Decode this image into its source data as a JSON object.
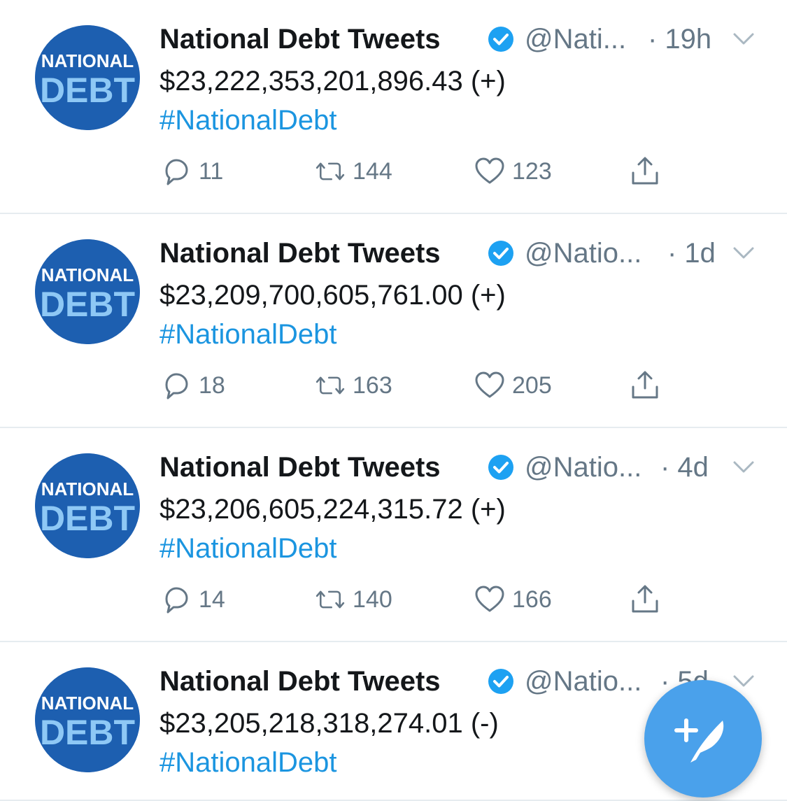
{
  "tweets": [
    {
      "name": "National Debt Tweets",
      "handle": "@Nati...",
      "time": "· 19h",
      "amount": "$23,222,353,201,896.43 (+)",
      "hashtag": "#NationalDebt",
      "replies": "11",
      "retweets": "144",
      "likes": "123"
    },
    {
      "name": "National Debt Tweets",
      "handle": "@Natio...",
      "time": "· 1d",
      "amount": "$23,209,700,605,761.00 (+)",
      "hashtag": "#NationalDebt",
      "replies": "18",
      "retweets": "163",
      "likes": "205"
    },
    {
      "name": "National Debt Tweets",
      "handle": "@Natio...",
      "time": "· 4d",
      "amount": "$23,206,605,224,315.72 (+)",
      "hashtag": "#NationalDebt",
      "replies": "14",
      "retweets": "140",
      "likes": "166"
    },
    {
      "name": "National Debt Tweets",
      "handle": "@Natio...",
      "time": "· 5d",
      "amount": "$23,205,218,318,274.01 (-)",
      "hashtag": "#NationalDebt"
    }
  ],
  "avatar": {
    "line1": "NATIONAL",
    "line2": "DEBT"
  },
  "icons": {
    "verified": "verified-badge-icon",
    "caret": "chevron-down-icon",
    "reply": "reply-icon",
    "retweet": "retweet-icon",
    "like": "heart-icon",
    "share": "share-icon",
    "compose": "compose-tweet-icon"
  },
  "colors": {
    "link": "#1b95e0",
    "verified": "#1da1f2",
    "fab": "#4aa1eb",
    "avatar": "#1d5fb0",
    "secondary_text": "#657786"
  }
}
